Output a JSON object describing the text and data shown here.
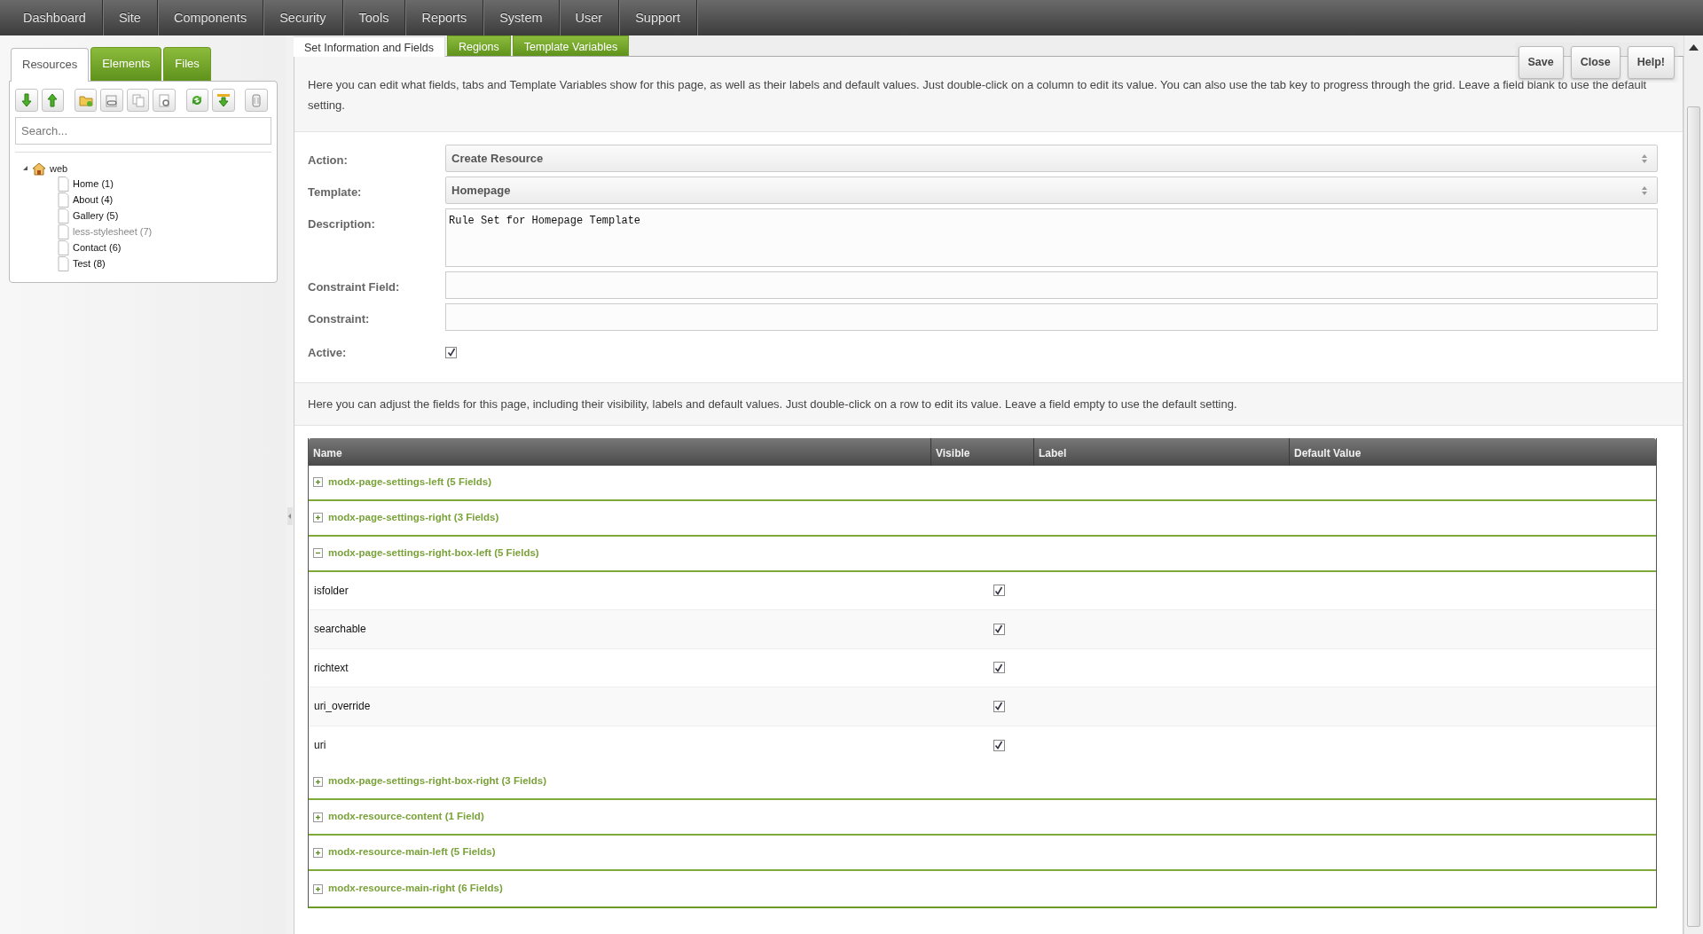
{
  "top_menu": [
    "Dashboard",
    "Site",
    "Components",
    "Security",
    "Tools",
    "Reports",
    "System",
    "User",
    "Support"
  ],
  "left_tabs": [
    {
      "label": "Resources",
      "selected": true
    },
    {
      "label": "Elements",
      "selected": false
    },
    {
      "label": "Files",
      "selected": false
    }
  ],
  "search": {
    "placeholder": "Search..."
  },
  "tree": {
    "label": "web",
    "expanded": true,
    "children": [
      {
        "label": "Home (1)",
        "unpublished": false
      },
      {
        "label": "About (4)",
        "unpublished": false
      },
      {
        "label": "Gallery (5)",
        "unpublished": false
      },
      {
        "label": "less-stylesheet (7)",
        "unpublished": true
      },
      {
        "label": "Contact (6)",
        "unpublished": false
      },
      {
        "label": "Test (8)",
        "unpublished": false
      }
    ]
  },
  "form_tabs": [
    {
      "label": "Set Information and Fields",
      "selected": true
    },
    {
      "label": "Regions",
      "selected": false
    },
    {
      "label": "Template Variables",
      "selected": false
    }
  ],
  "action_buttons": [
    "Save",
    "Close",
    "Help!"
  ],
  "intro": "Here you can edit what fields, tabs and Template Variables show for this page, as well as their labels and default values. Just double-click on a column to edit its value. You can also use the tab key to progress through the grid. Leave a field blank to use the default setting.",
  "form": {
    "action": {
      "label": "Action:",
      "value": "Create Resource"
    },
    "template": {
      "label": "Template:",
      "value": "Homepage"
    },
    "description": {
      "label": "Description:",
      "value": "Rule Set for Homepage Template"
    },
    "constraint_field": {
      "label": "Constraint Field:"
    },
    "constraint": {
      "label": "Constraint:"
    },
    "active": {
      "label": "Active:",
      "checked": true
    }
  },
  "fields_intro": "Here you can adjust the fields for this page, including their visibility, labels and default values. Just double-click on a row to edit its value. Leave a field empty to use the default setting.",
  "grid": {
    "columns": [
      "Name",
      "Visible",
      "Label",
      "Default Value"
    ],
    "groups": [
      {
        "name": "modx-page-settings-left (5 Fields)",
        "expanded": false
      },
      {
        "name": "modx-page-settings-right (3 Fields)",
        "expanded": false
      },
      {
        "name": "modx-page-settings-right-box-left (5 Fields)",
        "expanded": true,
        "rows": [
          {
            "name": "isfolder",
            "visible": true
          },
          {
            "name": "searchable",
            "visible": true
          },
          {
            "name": "richtext",
            "visible": true
          },
          {
            "name": "uri_override",
            "visible": true
          },
          {
            "name": "uri",
            "visible": true
          }
        ]
      },
      {
        "name": "modx-page-settings-right-box-right (3 Fields)",
        "expanded": false
      },
      {
        "name": "modx-resource-content (1 Field)",
        "expanded": false
      },
      {
        "name": "modx-resource-main-left (5 Fields)",
        "expanded": false
      },
      {
        "name": "modx-resource-main-right (6 Fields)",
        "expanded": false
      }
    ]
  }
}
